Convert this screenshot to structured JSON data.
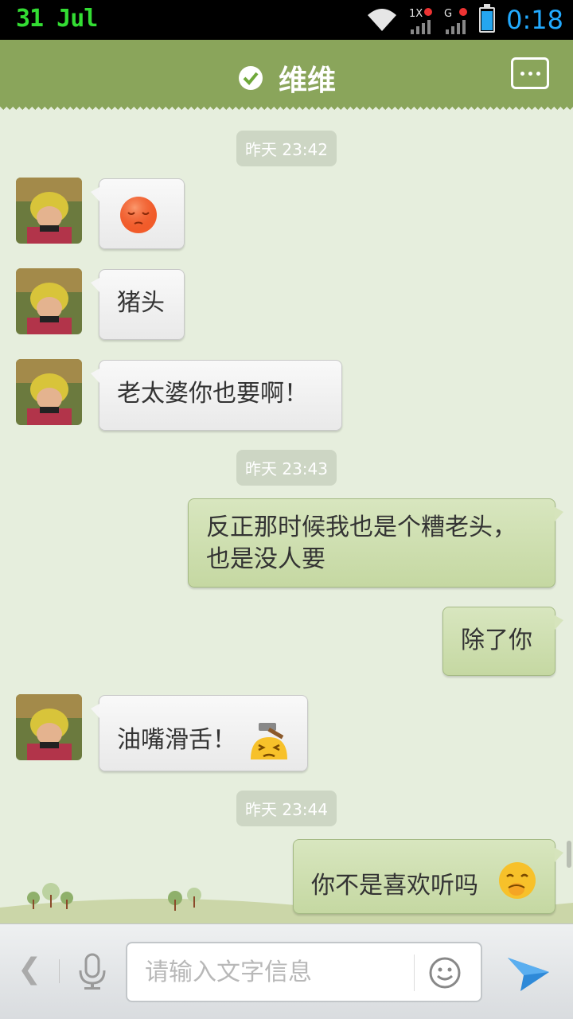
{
  "status_bar": {
    "date": "31 Jul",
    "time": "0:18",
    "icons": [
      "wifi-icon",
      "signal-1x-icon",
      "signal-g-icon",
      "battery-icon"
    ],
    "battery_level": 0.85
  },
  "title_bar": {
    "title": "维维",
    "icons": [
      "verified-check-icon",
      "more-menu-icon"
    ]
  },
  "messages": {
    "ts1": "昨天 23:42",
    "m1_emoji": "sad-face-emoji",
    "m2": "猪头",
    "m3": "老太婆你也要啊！",
    "ts2": "昨天 23:43",
    "m4": "反正那时候我也是个糟老头，也是没人要",
    "m5": "除了你",
    "m6": "油嘴滑舌！",
    "m6_emoji": "hammer-knock-emoji",
    "ts3": "昨天 23:44",
    "m7": "你不是喜欢听吗",
    "m7_emoji": "shy-laugh-emoji"
  },
  "input_bar": {
    "placeholder": "请输入文字信息",
    "icons": [
      "back-icon",
      "mic-icon",
      "smiley-icon",
      "send-icon"
    ]
  },
  "colors": {
    "title_bg": "#8aa55b",
    "chat_bg": "#e6eedd",
    "sent_bubble": "#c5d8a2",
    "received_bubble": "#f4f4f4",
    "send_icon": "#2e89d8"
  }
}
